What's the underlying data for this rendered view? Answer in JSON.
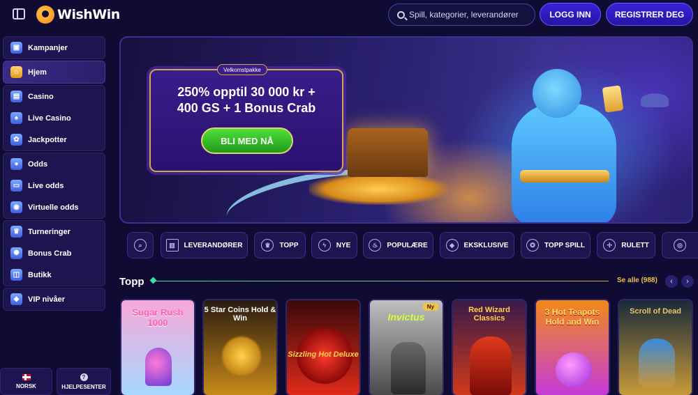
{
  "header": {
    "logo_text": "WishWin",
    "search_placeholder": "Spill, kategorier, leverandører",
    "login_label": "LOGG INN",
    "register_label": "REGISTRER DEG"
  },
  "sidebar": {
    "groups": [
      [
        {
          "label": "Kampanjer"
        }
      ],
      [
        {
          "label": "Hjem"
        }
      ],
      [
        {
          "label": "Casino"
        },
        {
          "label": "Live Casino"
        },
        {
          "label": "Jackpotter"
        }
      ],
      [
        {
          "label": "Odds"
        },
        {
          "label": "Live odds"
        },
        {
          "label": "Virtuelle odds"
        }
      ],
      [
        {
          "label": "Turneringer"
        },
        {
          "label": "Bonus Crab"
        },
        {
          "label": "Butikk"
        }
      ],
      [
        {
          "label": "VIP nivåer"
        }
      ]
    ],
    "language_label": "NORSK",
    "help_label": "HJELPESENTER"
  },
  "hero": {
    "tag": "Velkomstpakke",
    "title_line1": "250% opptil 30 000 kr +",
    "title_line2": "400 GS + 1 Bonus Crab",
    "cta": "BLI MED NÅ"
  },
  "categories": [
    {
      "label": "",
      "icon": "search-icon"
    },
    {
      "label": "LEVERANDØRER",
      "icon": "provider-icon"
    },
    {
      "label": "TOPP",
      "icon": "crown-icon"
    },
    {
      "label": "NYE",
      "icon": "lightning-icon"
    },
    {
      "label": "POPULÆRE",
      "icon": "fire-icon"
    },
    {
      "label": "EKSKLUSIVE",
      "icon": "diamond-icon"
    },
    {
      "label": "TOPP SPILL",
      "icon": "medal-icon"
    },
    {
      "label": "RULETT",
      "icon": "roulette-icon"
    }
  ],
  "section": {
    "title": "Topp",
    "see_all": "Se alle (988)"
  },
  "games": [
    {
      "name": "Sugar Rush 1000",
      "colors": [
        "#f7a8d8",
        "#a6d8ff"
      ]
    },
    {
      "name": "5 Star Coins Hold & Win",
      "colors": [
        "#2a1a10",
        "#c88a1a"
      ]
    },
    {
      "name": "Sizzling Hot Deluxe",
      "colors": [
        "#3a0a0a",
        "#e02a1a"
      ]
    },
    {
      "name": "Invictus",
      "colors": [
        "#bfbfbf",
        "#4a4a4a"
      ],
      "badge": "Ny"
    },
    {
      "name": "Red Wizard Classics",
      "colors": [
        "#3a1a4a",
        "#d03a1a"
      ]
    },
    {
      "name": "3 Hot Teapots Hold and Win",
      "colors": [
        "#f28a1a",
        "#c43ad8"
      ]
    },
    {
      "name": "Scroll of Dead",
      "colors": [
        "#1a2a3a",
        "#c89a3a"
      ]
    }
  ]
}
